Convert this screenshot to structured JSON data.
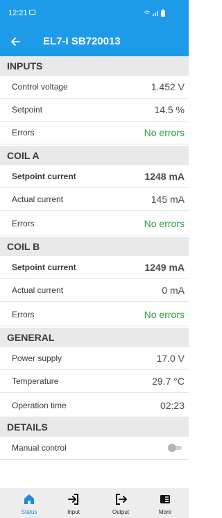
{
  "status_bar": {
    "time": "12:21"
  },
  "app_bar": {
    "title": "EL7-I SB720013"
  },
  "sections": {
    "inputs": {
      "title": "INPUTS",
      "rows": [
        {
          "label": "Control voltage",
          "value": "1.452 V"
        },
        {
          "label": "Setpoint",
          "value": "14.5 %"
        },
        {
          "label": "Errors",
          "value": "No errors"
        }
      ]
    },
    "coil_a": {
      "title": "COIL A",
      "rows": [
        {
          "label": "Setpoint current",
          "value": "1248 mA"
        },
        {
          "label": "Actual current",
          "value": "145 mA"
        },
        {
          "label": "Errors",
          "value": "No errors"
        }
      ]
    },
    "coil_b": {
      "title": "COIL B",
      "rows": [
        {
          "label": "Setpoint current",
          "value": "1249 mA"
        },
        {
          "label": "Actual current",
          "value": "0 mA"
        },
        {
          "label": "Errors",
          "value": "No errors"
        }
      ]
    },
    "general": {
      "title": "GENERAL",
      "rows": [
        {
          "label": "Power supply",
          "value": "17.0 V"
        },
        {
          "label": "Temperature",
          "value": "29.7 °C"
        },
        {
          "label": "Operation time",
          "value": "02:23"
        }
      ]
    },
    "details": {
      "title": "DETAILS",
      "rows": [
        {
          "label": "Manual control",
          "toggle_on": false
        }
      ]
    }
  },
  "bottom_nav": {
    "items": [
      {
        "label": "Status",
        "icon": "home-icon",
        "active": true
      },
      {
        "label": "Input",
        "icon": "input-icon",
        "active": false
      },
      {
        "label": "Output",
        "icon": "output-icon",
        "active": false
      },
      {
        "label": "More",
        "icon": "more-icon",
        "active": false
      }
    ]
  },
  "colors": {
    "primary": "#1e9be8",
    "section_bg": "#e9e9ea",
    "ok_text": "#27a143",
    "nav_active": "#1e8be0"
  }
}
